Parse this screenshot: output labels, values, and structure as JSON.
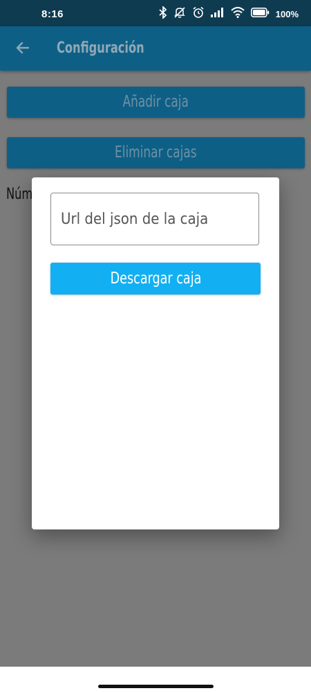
{
  "status_bar": {
    "time": "8:16",
    "battery": "100%",
    "icons": [
      "bluetooth-icon",
      "mute-icon",
      "alarm-icon",
      "signal-icon",
      "wifi-icon",
      "battery-icon"
    ]
  },
  "app_bar": {
    "back_icon": "arrow-left-icon",
    "title": "Configuración"
  },
  "background": {
    "add_box_label": "Añadir caja",
    "delete_boxes_label": "Eliminar cajas",
    "partial_label": "Núm"
  },
  "dialog": {
    "url_input_value": "",
    "url_input_placeholder": "Url del json de la caja",
    "download_button_label": "Descargar caja"
  },
  "colors": {
    "status_bar": "#0f3b51",
    "app_bar": "#0e5f86",
    "scrim": "#7b7b7b",
    "accent": "#12b0f3"
  }
}
